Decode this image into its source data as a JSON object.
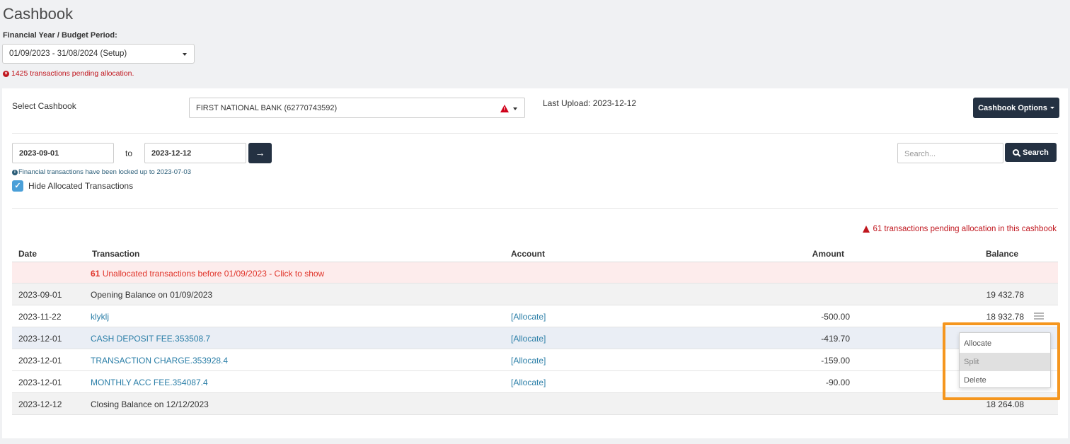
{
  "page": {
    "title": "Cashbook",
    "fy_label": "Financial Year / Budget Period:",
    "fy_value": "01/09/2023 - 31/08/2024 (Setup)",
    "pending_global": "1425 transactions pending allocation."
  },
  "cashbook": {
    "select_label": "Select Cashbook",
    "bank_value": "FIRST NATIONAL BANK (62770743592)",
    "last_upload": "Last Upload: 2023-12-12",
    "options_label": "Cashbook Options"
  },
  "filters": {
    "date_from": "2023-09-01",
    "to_label": "to",
    "date_to": "2023-12-12",
    "lock_note": "Financial transactions have been locked up to 2023-07-03",
    "hide_allocated_label": "Hide Allocated Transactions",
    "hide_allocated_checked": true,
    "search_placeholder": "Search...",
    "search_label": "Search"
  },
  "pending_cashbook": "61 transactions pending allocation in this cashbook",
  "table": {
    "headers": {
      "date": "Date",
      "transaction": "Transaction",
      "account": "Account",
      "amount": "Amount",
      "balance": "Balance"
    },
    "unallocated_count": "61",
    "unallocated_text": "Unallocated transactions before 01/09/2023 - Click to show",
    "rows": [
      {
        "date": "2023-09-01",
        "transaction": "Opening Balance on 01/09/2023",
        "account": "",
        "amount": "",
        "balance": "19 432.78"
      },
      {
        "date": "2023-11-22",
        "transaction": "klyklj",
        "account": "[Allocate]",
        "amount": "-500.00",
        "balance": "18 932.78"
      },
      {
        "date": "2023-12-01",
        "transaction": "CASH DEPOSIT FEE.353508.7",
        "account": "[Allocate]",
        "amount": "-419.70",
        "balance": ""
      },
      {
        "date": "2023-12-01",
        "transaction": "TRANSACTION CHARGE.353928.4",
        "account": "[Allocate]",
        "amount": "-159.00",
        "balance": ""
      },
      {
        "date": "2023-12-01",
        "transaction": "MONTHLY ACC FEE.354087.4",
        "account": "[Allocate]",
        "amount": "-90.00",
        "balance": ""
      },
      {
        "date": "2023-12-12",
        "transaction": "Closing Balance on 12/12/2023",
        "account": "",
        "amount": "",
        "balance": "18 264.08"
      }
    ]
  },
  "context_menu": {
    "items": [
      "Allocate",
      "Split",
      "Delete"
    ],
    "active": "Split"
  },
  "colors": {
    "primary_button": "#243142",
    "error_red": "#c0161e",
    "link_blue": "#2a7ea7",
    "highlight_orange": "#f5961e"
  }
}
